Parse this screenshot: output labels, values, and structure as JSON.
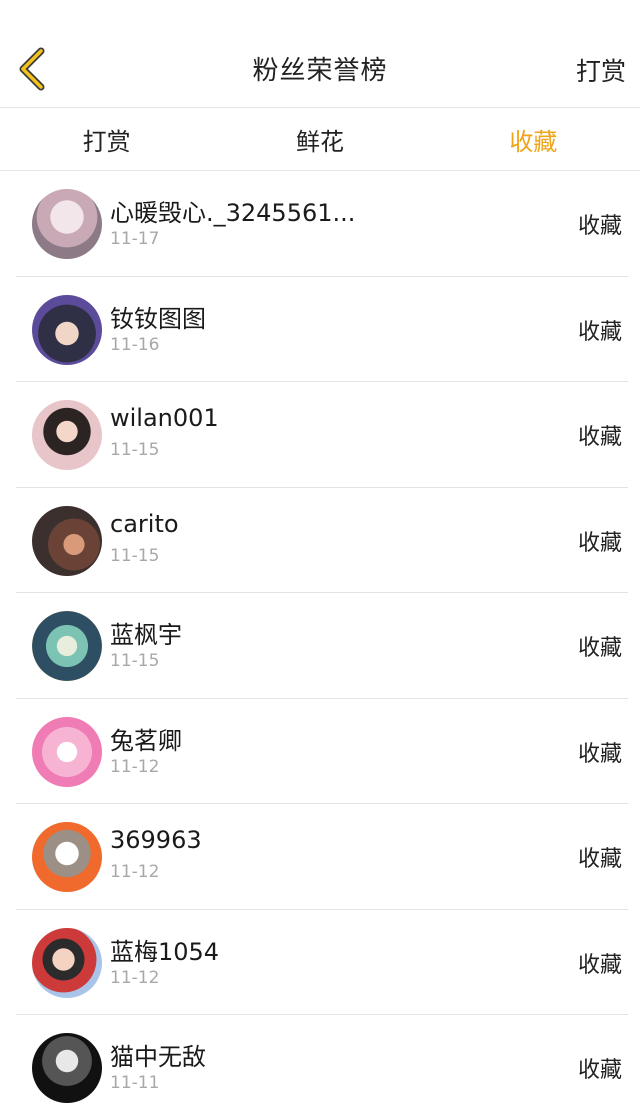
{
  "header": {
    "title": "粉丝荣誉榜",
    "right_action": "打赏"
  },
  "tabs": [
    {
      "label": "打赏"
    },
    {
      "label": "鲜花"
    },
    {
      "label": "收藏"
    }
  ],
  "active_tab_color": "#f0a417",
  "fans": [
    {
      "name": "心暖毁心._3245561...",
      "date": "11-17",
      "action": "收藏"
    },
    {
      "name": "钕钕图图",
      "date": "11-16",
      "action": "收藏"
    },
    {
      "name": "wilan001",
      "date": "11-15",
      "action": "收藏"
    },
    {
      "name": "carito",
      "date": "11-15",
      "action": "收藏"
    },
    {
      "name": "蓝枫宇",
      "date": "11-15",
      "action": "收藏"
    },
    {
      "name": "兔茗卿",
      "date": "11-12",
      "action": "收藏"
    },
    {
      "name": "369963",
      "date": "11-12",
      "action": "收藏"
    },
    {
      "name": "蓝梅1054",
      "date": "11-12",
      "action": "收藏"
    },
    {
      "name": "猫中无敌",
      "date": "11-11",
      "action": "收藏"
    }
  ]
}
